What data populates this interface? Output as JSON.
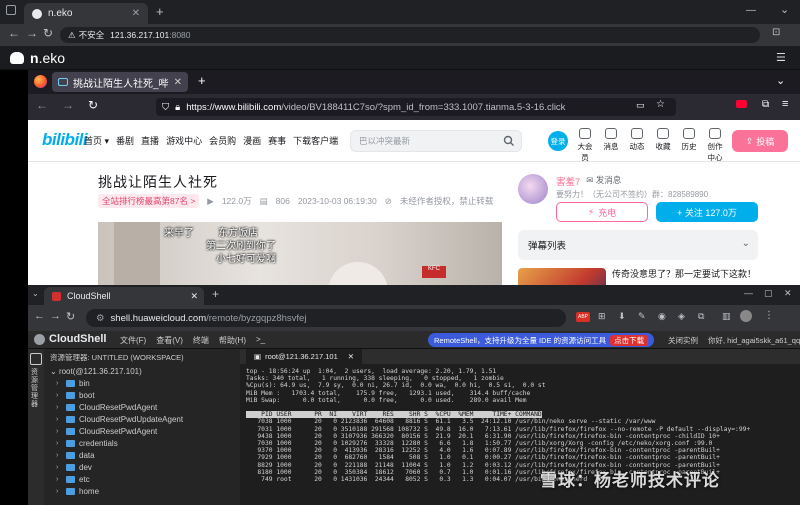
{
  "outer_browser": {
    "tab_title": "n.eko",
    "security_label": "不安全",
    "url_host": "121.36.217.101",
    "url_port": ":8080"
  },
  "neko": {
    "logo_bold": "n",
    "logo_rest": ".eko"
  },
  "firefox": {
    "tab_title": "挑战让陌生人社死_哔",
    "url_domain": "https://www.bilibili.com",
    "url_path": "/video/BV188411C7so/?spm_id_from=333.1007.tianma.5-3-16.click"
  },
  "bilibili": {
    "logo": "bilibili",
    "nav": [
      "首页 ▾",
      "番剧",
      "直播",
      "游戏中心",
      "会员购",
      "漫画",
      "赛事",
      "下载客户端"
    ],
    "search_placeholder": "巴以冲突最新",
    "login": "登录",
    "header_icons": [
      "大会员",
      "消息",
      "动态",
      "收藏",
      "历史",
      "创作中心"
    ],
    "upload": "投稿",
    "video_title": "挑战让陌生人社死",
    "rank": "全站排行榜最高第87名 >",
    "views": "122.0万",
    "danmaku_count": "806",
    "date": "2023-10-03 06:19:30",
    "copyright": "未经作者授权，禁止转载",
    "captions": [
      "来早了",
      "东方饭店",
      "第二次刷到你了",
      "小七好可爱啊"
    ],
    "store_sign": "KFC",
    "uploader": {
      "name": "害羞7",
      "message": "发消息",
      "desc": "要努力！（无公司不签约）群：828589890",
      "charge": "充电",
      "follow": "+ 关注 127.0万"
    },
    "danmu_list": "弹幕列表",
    "rec_title": "传奇没意思了？那一定要试下这款！"
  },
  "cloudshell_browser": {
    "tab_title": "CloudShell",
    "url_domain": "shell.huaweicloud.com",
    "url_path": "/remote/byzgqpz8hsvfej"
  },
  "cloudshell": {
    "brand": "CloudShell",
    "menu": [
      "文件(F)",
      "查看(V)",
      "终端",
      "帮助(H)",
      ">_"
    ],
    "remote_banner": "RemoteShell，支持升级为全量 IDE 的资源访问工具",
    "remote_button": "点击下载",
    "right": [
      "关闭实例",
      "你好, hid_agai5skk_a61_qq"
    ],
    "explorer_title": "资源管理器: UNTITLED (WORKSPACE)",
    "side_label": "资源管理器",
    "root": "root(@121.36.217.101)",
    "folders": [
      "bin",
      "boot",
      "CloudResetPwdAgent",
      "CloudResetPwdUpdateAgent",
      "CloudResetPwdAgent",
      "credentials",
      "data",
      "dev",
      "etc",
      "home"
    ],
    "terminal_tab": "root@121.36.217.101",
    "top_lines": [
      "top - 18:56:24 up  1:04,  2 users,  load average: 2.20, 1.79, 1.51",
      "Tasks: 340 total,   1 running, 338 sleeping,   0 stopped,   1 zombie",
      "%Cpu(s): 64.9 us,  7.9 sy,  0.0 ni, 26.7 id,  0.0 wa,  0.0 hi,  0.5 si,  0.0 st",
      "MiB Mem :   1703.4 total,    175.9 free,   1293.1 used,    314.4 buff/cache",
      "MiB Swap:      0.0 total,      0.0 free,      0.0 used.    289.0 avail Mem",
      ""
    ],
    "top_header": "    PID USER      PR  NI    VIRT    RES    SHR S  %CPU  %MEM     TIME+ COMMAND",
    "processes": [
      "   7038 1000      20   0 2123836  64608   8816 S  61.1   3.5  24:12.10 /usr/bin/neko serve --static /var/www",
      "   7031 1000      20   0 3510188 291568 108732 S  49.8  16.0   7:13.61 /usr/lib/firefox/firefox --no-remote -P default --display=:99+",
      "   9438 1000      20   0 3107936 366320  80156 S  21.9  20.1   6:31.90 /usr/lib/firefox/firefox-bin -contentproc -childID 10+",
      "   7030 1000      20   0 1029276  33328  12280 S   6.6   1.8   1:50.77 /usr/lib/xorg/Xorg -config /etc/neko/xorg.conf :99.0",
      "   9370 1000      20   0  413936  28316  12252 S   4.0   1.6   0:07.89 /usr/lib/firefox/firefox-bin -contentproc -parentBuil+",
      "   7929 1000      20   0  682760   1584    508 S   1.0   0.1   0:00.27 /usr/lib/firefox/firefox-bin -contentproc -parentBuil+",
      "   8829 1000      20   0  221188  21148  11004 S   1.0   1.2   0:03.12 /usr/lib/firefox/firefox-bin -contentproc -parentBuil+",
      "   8180 1000      20   0  350384  18612   7060 S   0.7   1.0   0:01.16 /usr/lib/firefox/firefox-bin -contentproc -parentBuil+",
      "    749 root      20   0 1431036  24344   8052 S   0.3   1.3   0:04.07 /usr/bin/containerd"
    ]
  },
  "watermark": "雪球：杨老师技术评论",
  "colors": {
    "bili_blue": "#00aeec",
    "bili_pink": "#fb7299",
    "remote_blue": "#3b5bdb"
  }
}
